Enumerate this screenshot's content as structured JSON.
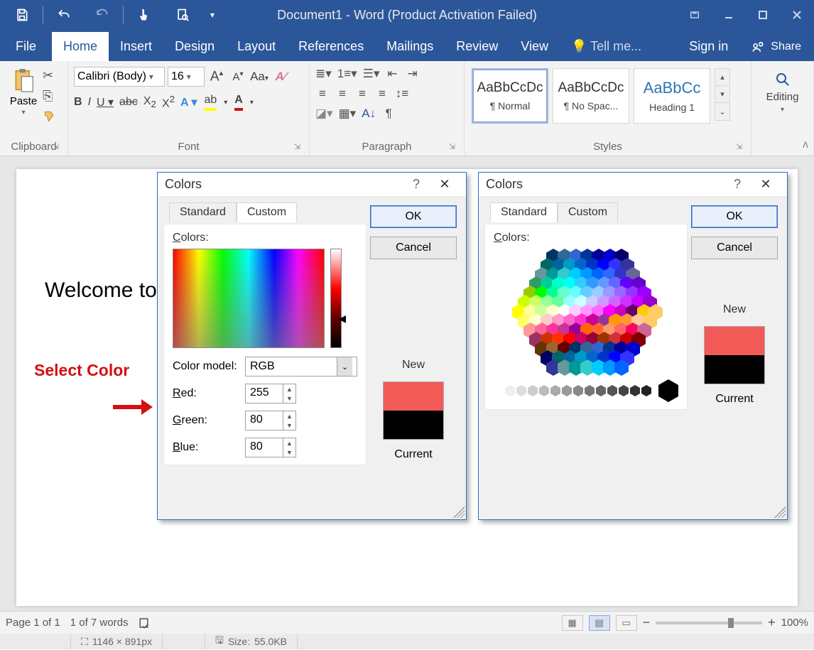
{
  "window": {
    "title": "Document1 - Word (Product Activation Failed)"
  },
  "tabs": {
    "file": "File",
    "home": "Home",
    "insert": "Insert",
    "design": "Design",
    "layout": "Layout",
    "references": "References",
    "mailings": "Mailings",
    "review": "Review",
    "view": "View",
    "tell_me": "Tell me...",
    "signin": "Sign in",
    "share": "Share"
  },
  "ribbon": {
    "clipboard": {
      "paste": "Paste",
      "label": "Clipboard"
    },
    "font": {
      "name": "Calibri (Body)",
      "size": "16",
      "label": "Font",
      "case": "Aa",
      "clear": "A"
    },
    "paragraph": {
      "label": "Paragraph"
    },
    "styles": {
      "label": "Styles",
      "items": [
        {
          "preview": "AaBbCcDc",
          "name": "¶ Normal"
        },
        {
          "preview": "AaBbCcDc",
          "name": "¶ No Spac..."
        },
        {
          "preview": "AaBbCc",
          "name": "Heading 1"
        }
      ]
    },
    "editing": {
      "label": "Editing"
    }
  },
  "document": {
    "body_text": "Welcome to",
    "annotation": "Select Color"
  },
  "dialog_common": {
    "title": "Colors",
    "ok": "OK",
    "cancel": "Cancel",
    "new": "New",
    "current": "Current",
    "colors_label": "Colors:",
    "tab_standard": "Standard",
    "tab_custom": "Custom"
  },
  "dialog_custom": {
    "color_model_label": "Color model:",
    "color_model_value": "RGB",
    "red_label": "Red:",
    "red": "255",
    "green_label": "Green:",
    "green": "80",
    "blue_label": "Blue:",
    "blue": "80",
    "new_color": "#f25a57",
    "current_color": "#000000"
  },
  "dialog_standard": {
    "new_color": "#f25a57",
    "current_color": "#000000"
  },
  "status": {
    "page": "Page 1 of 1",
    "words": "1 of 7 words",
    "zoom": "100%",
    "dims": "1146 × 891px",
    "size_label": "Size:",
    "size": "55.0KB"
  }
}
